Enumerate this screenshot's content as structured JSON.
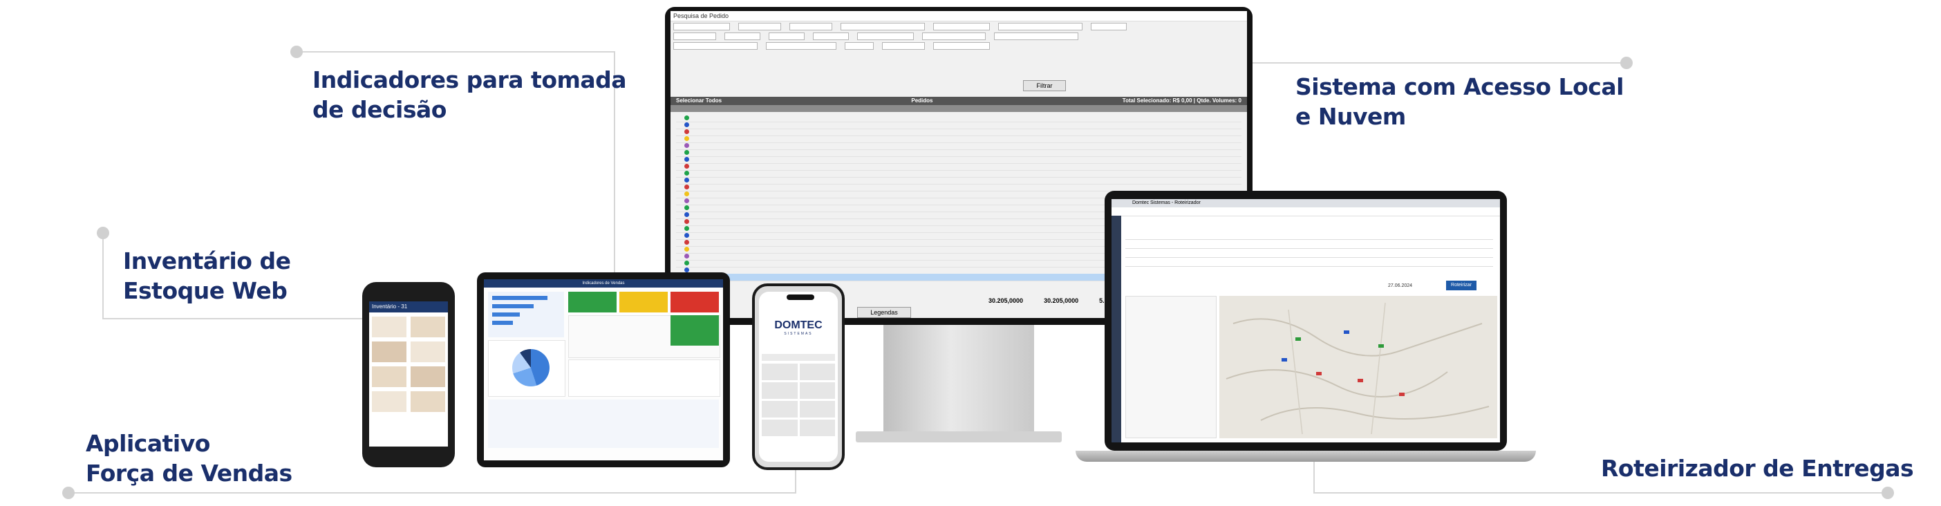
{
  "labels": {
    "decisao": [
      "Indicadores para tomada",
      "de decisão"
    ],
    "estoque": [
      "Inventário de",
      "Estoque Web"
    ],
    "forca": [
      "Aplicativo",
      "Força de Vendas"
    ],
    "acesso": [
      "Sistema com Acesso Local",
      "e Nuvem"
    ],
    "roteirizador": [
      "Roteirizador de Entregas"
    ]
  },
  "monitor": {
    "window_title": "Pesquisa de Pedido",
    "grid_header": "Pedidos",
    "total_label": "Total Selecionado: R$ 0,00 | Qtde. Volumes: 0",
    "selecionar_label": "Selecionar Todos",
    "filtrar_label": "Filtrar",
    "legendas_label": "Legendas",
    "totals": [
      "30.205,0000",
      "30.205,0000",
      "5.02"
    ]
  },
  "laptop": {
    "tab_title": "Domtec Sistemas - Roteirizador",
    "date": "27.06.2024",
    "button": "Roteirizar"
  },
  "tablet": {
    "title": "Indicadores de Vendas"
  },
  "handheld": {
    "title": "Inventário - 31"
  },
  "iphone": {
    "brand": "DOMTEC",
    "brand_sub": "SISTEMAS"
  },
  "colors": {
    "label": "#1a2f6b",
    "connector": "#d6d6d6"
  }
}
